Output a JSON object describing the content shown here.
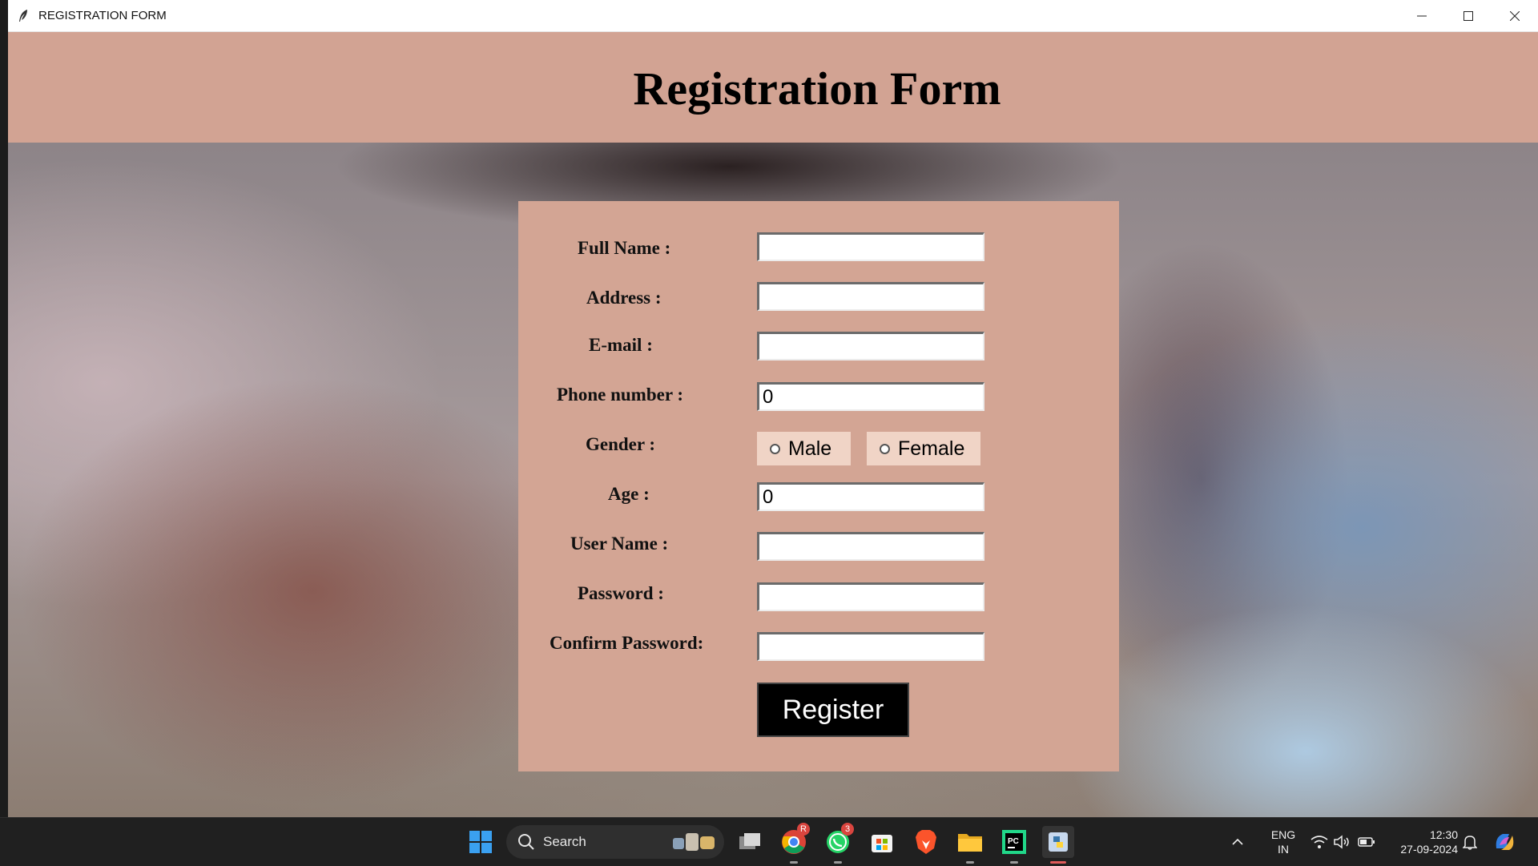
{
  "window": {
    "title": "REGISTRATION FORM",
    "controls": [
      "minimize",
      "maximize",
      "close"
    ]
  },
  "header": {
    "heading": "Registration Form"
  },
  "form": {
    "full_name": {
      "label": "Full Name :",
      "value": ""
    },
    "address": {
      "label": "Address :",
      "value": ""
    },
    "email": {
      "label": "E-mail :",
      "value": ""
    },
    "phone": {
      "label": "Phone number :",
      "value": "0"
    },
    "gender": {
      "label": "Gender :",
      "options": [
        "Male",
        "Female"
      ],
      "selected": null
    },
    "age": {
      "label": "Age :",
      "value": "0"
    },
    "username": {
      "label": "User Name :",
      "value": ""
    },
    "password": {
      "label": "Password :",
      "value": ""
    },
    "confirm_password": {
      "label": "Confirm Password:",
      "value": ""
    },
    "register_label": "Register"
  },
  "taskbar": {
    "search_label": "Search",
    "apps": [
      "windows-start",
      "search",
      "task-view",
      "chrome",
      "whatsapp",
      "microsoft-store",
      "brave",
      "file-explorer",
      "pycharm",
      "python"
    ],
    "chrome_badge": "R",
    "whatsapp_badge": "3",
    "language": "ENG",
    "region": "IN",
    "time": "12:30",
    "date": "27-09-2024"
  },
  "colors": {
    "header_band": "#d2a393",
    "form_panel": "#d3a594",
    "radio_bg": "#f0d4c6",
    "register_bg": "#000000",
    "taskbar": "#202020"
  }
}
